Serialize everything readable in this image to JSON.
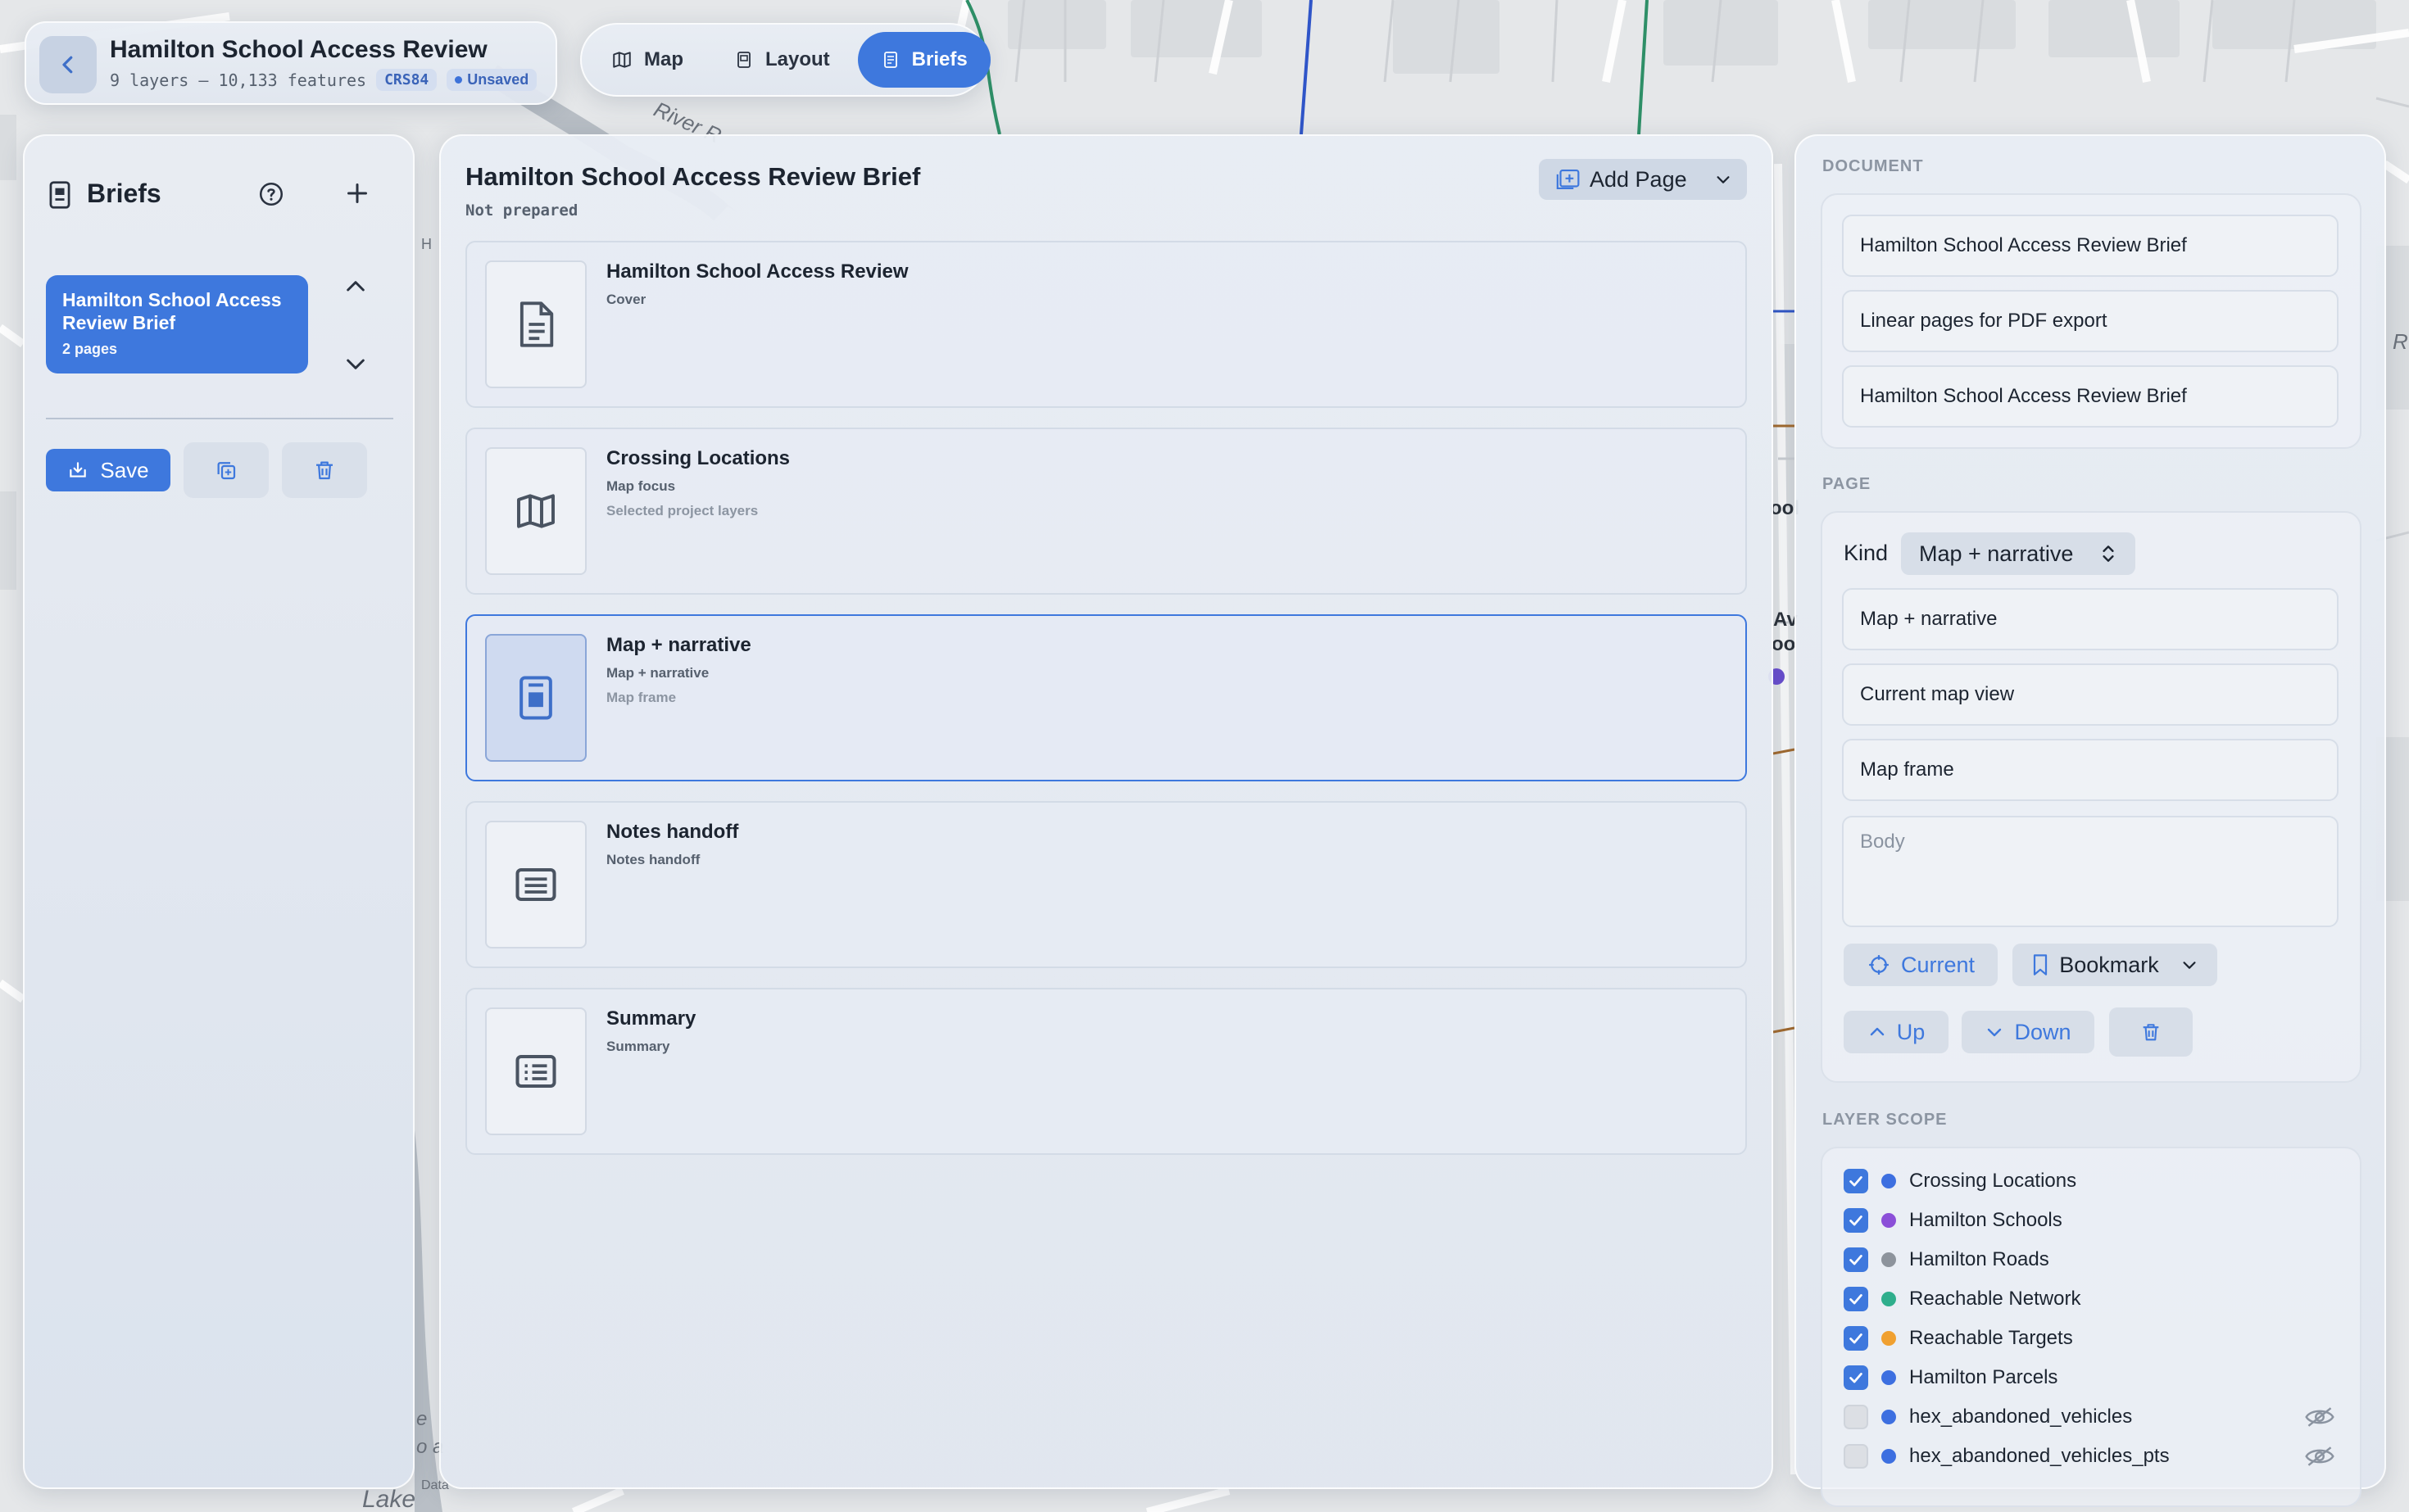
{
  "header": {
    "title": "Hamilton School Access Review",
    "meta": "9 layers – 10,133 features",
    "crs": "CRS84",
    "status": "Unsaved"
  },
  "switcher": {
    "tabs": [
      {
        "label": "Map",
        "icon": "map-icon",
        "active": false
      },
      {
        "label": "Layout",
        "icon": "layout-icon",
        "active": false
      },
      {
        "label": "Briefs",
        "icon": "brief-icon",
        "active": true
      }
    ]
  },
  "left": {
    "heading": "Briefs",
    "brief": {
      "title": "Hamilton School Access Review Brief",
      "pages": "2 pages"
    },
    "save_label": "Save"
  },
  "center": {
    "title": "Hamilton School Access Review Brief",
    "status": "Not prepared",
    "add_page_label": "Add Page",
    "pages": [
      {
        "title": "Hamilton School Access Review",
        "kind": "Cover",
        "detail": "",
        "icon": "document-icon"
      },
      {
        "title": "Crossing Locations",
        "kind": "Map focus",
        "detail": "Selected project layers",
        "icon": "map-icon"
      },
      {
        "title": "Map + narrative",
        "kind": "Map + narrative",
        "detail": "Map frame",
        "icon": "map-narrative-icon"
      },
      {
        "title": "Notes handoff",
        "kind": "Notes handoff",
        "detail": "",
        "icon": "notes-icon"
      },
      {
        "title": "Summary",
        "kind": "Summary",
        "detail": "",
        "icon": "summary-icon"
      }
    ]
  },
  "right": {
    "document_label": "DOCUMENT",
    "document_fields": [
      "Hamilton School Access Review Brief",
      "Linear pages for PDF export",
      "Hamilton School Access Review Brief"
    ],
    "page_label": "PAGE",
    "kind_label": "Kind",
    "kind_value": "Map + narrative",
    "page_fields": [
      "Map + narrative",
      "Current map view",
      "Map frame"
    ],
    "body_placeholder": "Body",
    "current_label": "Current",
    "bookmark_label": "Bookmark",
    "up_label": "Up",
    "down_label": "Down",
    "layer_scope_label": "LAYER SCOPE",
    "layers": [
      {
        "name": "Crossing Locations",
        "checked": true,
        "color": "#3d6fe0",
        "hidden": false
      },
      {
        "name": "Hamilton Schools",
        "checked": true,
        "color": "#8b4fd8",
        "hidden": false
      },
      {
        "name": "Hamilton Roads",
        "checked": true,
        "color": "#8d939c",
        "hidden": false
      },
      {
        "name": "Reachable Network",
        "checked": true,
        "color": "#2fae8c",
        "hidden": false
      },
      {
        "name": "Reachable Targets",
        "checked": true,
        "color": "#f0a030",
        "hidden": false
      },
      {
        "name": "Hamilton Parcels",
        "checked": true,
        "color": "#3d6fe0",
        "hidden": false
      },
      {
        "name": "hex_abandoned_vehicles",
        "checked": false,
        "color": "#3d6fe0",
        "hidden": true
      },
      {
        "name": "hex_abandoned_vehicles_pts",
        "checked": false,
        "color": "#3d6fe0",
        "hidden": true
      }
    ]
  },
  "map": {
    "labels": [
      "River R",
      "H",
      "ool",
      "Av",
      "oo",
      "R",
      "Lake",
      "Data",
      "e",
      "o a"
    ]
  }
}
